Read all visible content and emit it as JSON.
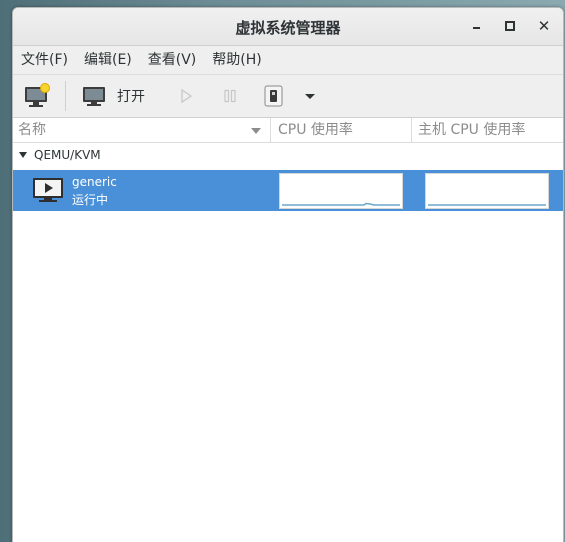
{
  "window": {
    "title": "虚拟系统管理器"
  },
  "menu": {
    "file": "文件(F)",
    "edit": "编辑(E)",
    "view": "查看(V)",
    "help": "帮助(H)"
  },
  "toolbar": {
    "open_label": "打开"
  },
  "columns": {
    "name": "名称",
    "cpu_usage": "CPU 使用率",
    "host_cpu_usage": "主机 CPU 使用率"
  },
  "connection": {
    "label": "QEMU/KVM"
  },
  "vm": {
    "name": "generic",
    "status": "运行中"
  },
  "colors": {
    "selection": "#4a90d9",
    "graph_line": "#6aa8c8"
  }
}
